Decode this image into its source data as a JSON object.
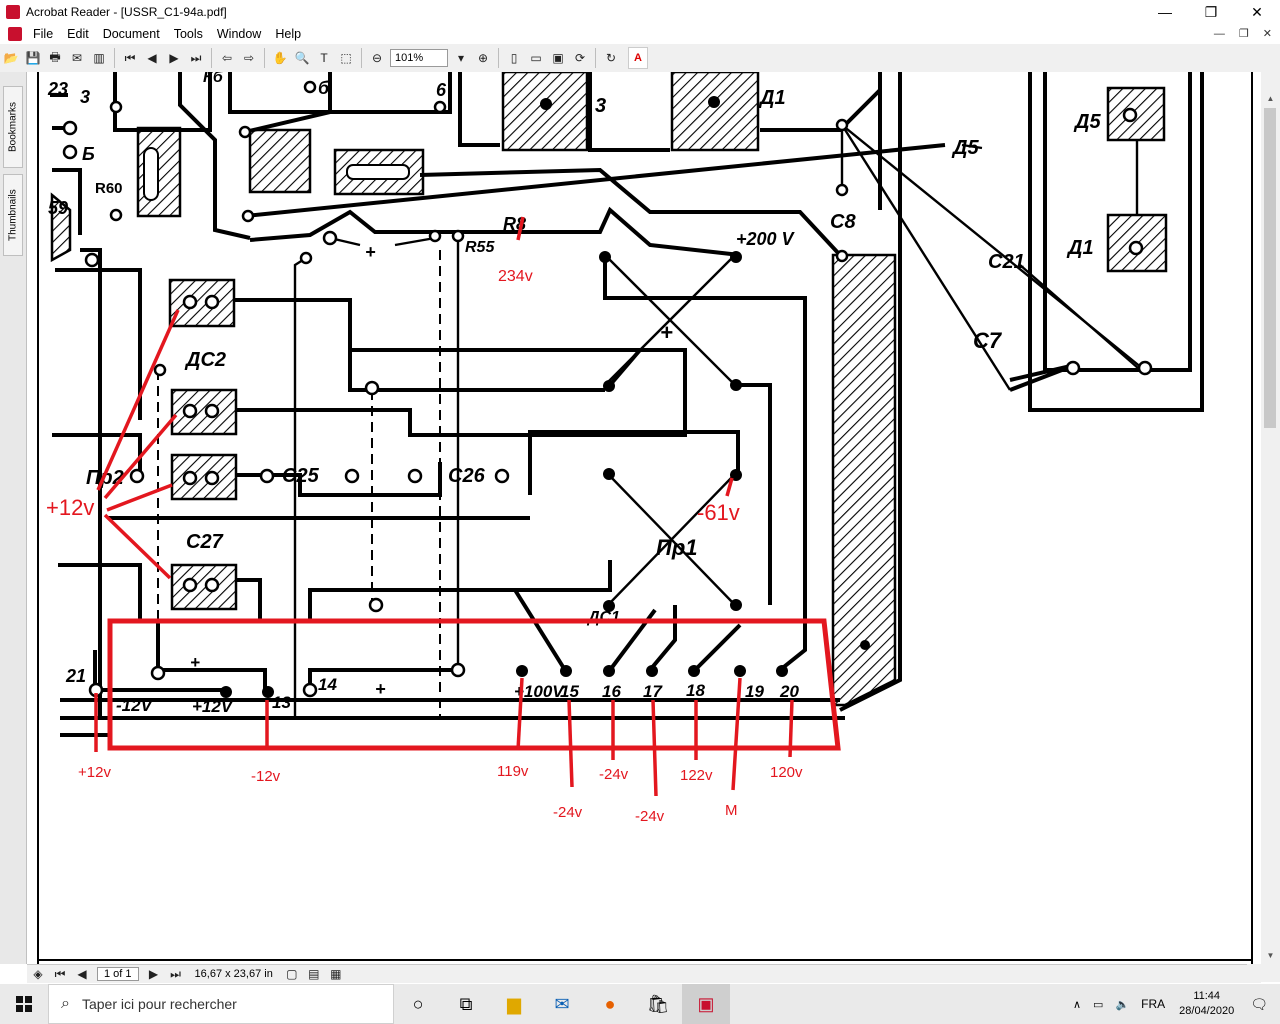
{
  "window": {
    "title": "Acrobat Reader - [USSR_C1-94a.pdf]",
    "min": "—",
    "max": "❐",
    "close": "✕"
  },
  "menu": {
    "items": [
      "File",
      "Edit",
      "Tools",
      "Document",
      "Window",
      "Help"
    ],
    "doc_min": "—",
    "doc_max": "❐",
    "doc_close": "✕"
  },
  "toolbar": {
    "zoom": "101%",
    "adobe_label": "A"
  },
  "sidebar": {
    "bookmarks": "Bookmarks",
    "thumbnails": "Thumbnails"
  },
  "status": {
    "page": "1 of 1",
    "size": "16,67 x 23,67 in"
  },
  "schematic": {
    "printed_labels": [
      "23",
      "3",
      "Б",
      "б",
      "R60",
      "59",
      "Кб",
      "6",
      "3",
      "Д1",
      "Д5",
      "Д1",
      "Д5",
      "С8",
      "С21",
      "С7",
      "R8",
      "+200 V",
      "+",
      "R55",
      "+",
      "ДС2",
      "Пр2",
      "С25",
      "С26",
      "С27",
      "Пр1",
      "ДС1",
      "+",
      "-12V",
      "+12V",
      "13",
      "14",
      "+",
      "+100V",
      "15",
      "16",
      "17",
      "18",
      "19",
      "20",
      "21",
      "+"
    ],
    "annotations": [
      "234v",
      "+12v",
      "-61v",
      "+12v",
      "-12v",
      "119v",
      "-24v",
      "-24v",
      "-24v",
      "122v",
      "M",
      "120v"
    ]
  },
  "taskbar": {
    "search_placeholder": "Taper ici pour rechercher",
    "lang": "FRA",
    "time": "11:44",
    "date": "28/04/2020"
  }
}
